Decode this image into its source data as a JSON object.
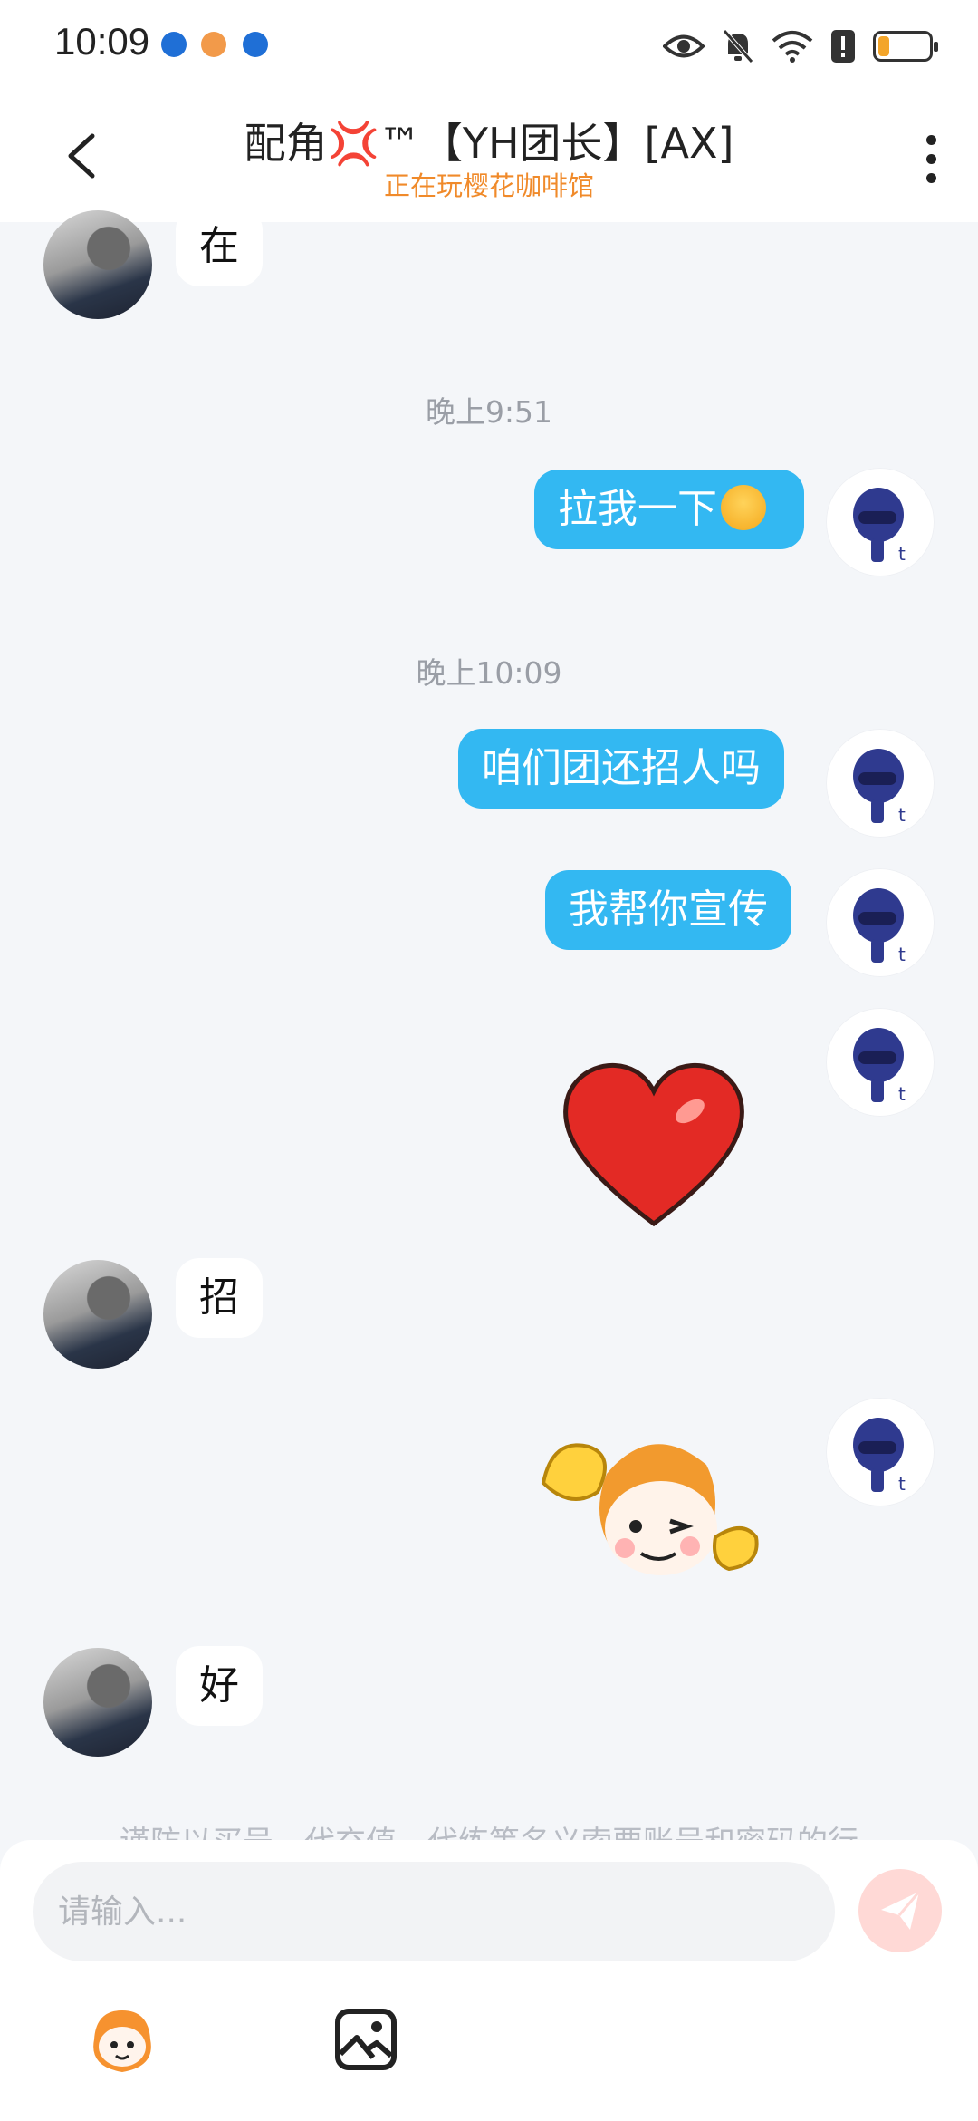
{
  "status_bar": {
    "time": "10:09",
    "notification_icons": [
      "shield-icon",
      "pause-app-icon",
      "shield-icon"
    ],
    "system_icons": [
      "eye-icon",
      "bell-off-icon",
      "wifi-icon",
      "alert-icon",
      "battery-icon"
    ],
    "battery_level": 0.2
  },
  "header": {
    "title": "配角💢™【YH团长】[AX]",
    "subtitle": "正在玩樱花咖啡馆",
    "back_icon": "chevron-left-icon",
    "more_icon": "more-vertical-icon"
  },
  "messages": [
    {
      "side": "in",
      "type": "text",
      "text": "在"
    },
    {
      "type": "timestamp",
      "text": "晚上9:51"
    },
    {
      "side": "out",
      "type": "text",
      "text": "拉我一下",
      "emoji": "yum-face"
    },
    {
      "type": "timestamp",
      "text": "晚上10:09"
    },
    {
      "side": "out",
      "type": "text",
      "text": "咱们团还招人吗"
    },
    {
      "side": "out",
      "type": "text",
      "text": "我帮你宣传"
    },
    {
      "side": "out",
      "type": "sticker",
      "sticker": "red-heart"
    },
    {
      "side": "in",
      "type": "text",
      "text": "招"
    },
    {
      "side": "out",
      "type": "sticker",
      "sticker": "mascot-ok-thumbs-up"
    },
    {
      "side": "in",
      "type": "text",
      "text": "好"
    }
  ],
  "warning": "谨防以买号、代充值、代练等名义索要账号和密码的行",
  "input": {
    "placeholder": "请输入...",
    "value": ""
  },
  "toolbar": {
    "icons": [
      "sticker-icon",
      "image-icon",
      "send-icon"
    ]
  },
  "colors": {
    "outgoing_bubble": "#33b8f2",
    "incoming_bubble": "#ffffff",
    "subtitle": "#f08a2a",
    "background": "#f4f6f9",
    "send_button": "#ffd9d6"
  }
}
